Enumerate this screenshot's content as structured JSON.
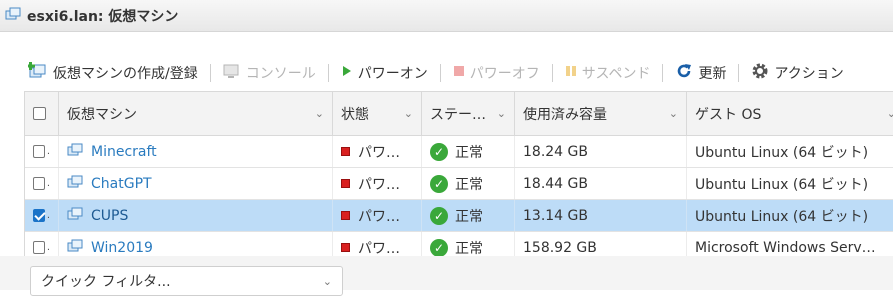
{
  "window": {
    "title": "esxi6.lan: 仮想マシン"
  },
  "toolbar": {
    "create": "仮想マシンの作成/登録",
    "console": "コンソール",
    "power_on": "パワーオン",
    "power_off": "パワーオフ",
    "suspend": "サスペンド",
    "refresh": "更新",
    "actions": "アクション"
  },
  "grid": {
    "headers": [
      "仮想マシン",
      "状態",
      "ステー…",
      "使用済み容量",
      "ゲスト OS"
    ],
    "rows": [
      {
        "name": "Minecraft",
        "state": "パワ…",
        "status": "正常",
        "used": "18.24 GB",
        "os": "Ubuntu Linux (64 ビット)",
        "checked": false
      },
      {
        "name": "ChatGPT",
        "state": "パワ…",
        "status": "正常",
        "used": "18.44 GB",
        "os": "Ubuntu Linux (64 ビット)",
        "checked": false
      },
      {
        "name": "CUPS",
        "state": "パワ…",
        "status": "正常",
        "used": "13.14 GB",
        "os": "Ubuntu Linux (64 ビット)",
        "checked": true
      },
      {
        "name": "Win2019",
        "state": "パワ…",
        "status": "正常",
        "used": "158.92 GB",
        "os": "Microsoft Windows Serv…",
        "checked": false
      }
    ]
  },
  "filter": {
    "label": "クイック フィルタ..."
  },
  "colors": {
    "accent": "#1a73c8",
    "link": "#2a7bbf",
    "selected_row": "#bddcf7",
    "ok": "#3aa83a",
    "stopped": "#d92020"
  }
}
